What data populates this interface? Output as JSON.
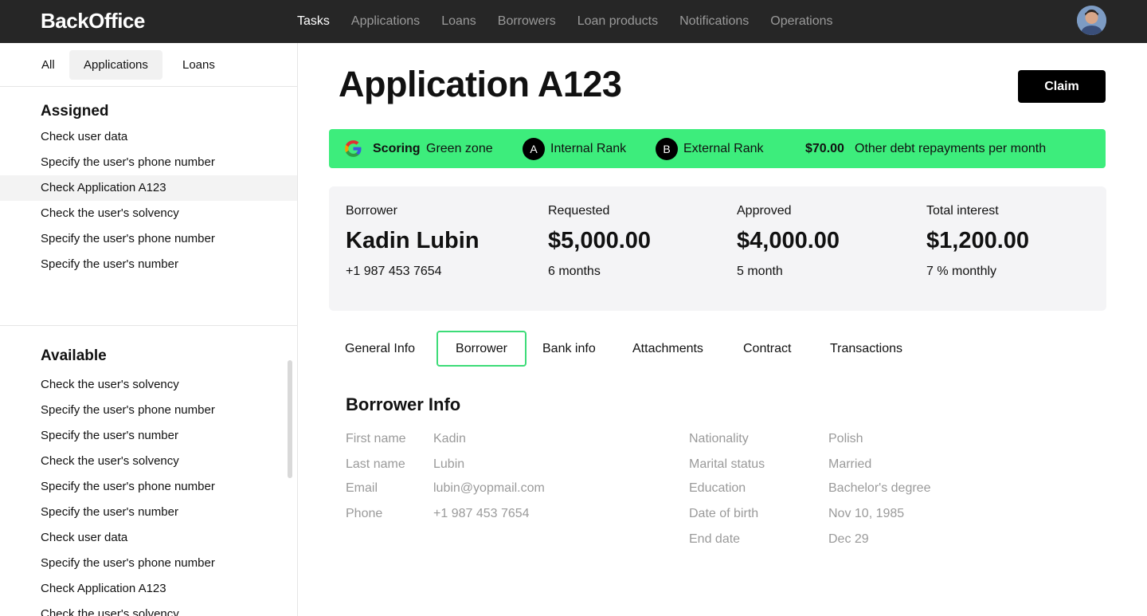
{
  "header": {
    "logo": "BackOffice",
    "nav": [
      "Tasks",
      "Applications",
      "Loans",
      "Borrowers",
      "Loan products",
      "Notifications",
      "Operations"
    ],
    "active_nav": "Tasks"
  },
  "sidebar": {
    "tabs": [
      "All",
      "Applications",
      "Loans"
    ],
    "active_tab": "Applications",
    "assigned": {
      "title": "Assigned",
      "items": [
        "Check user data",
        "Specify the user's phone number",
        "Check Application A123",
        "Check the user's solvency",
        "Specify the user's phone number",
        "Specify the user's number"
      ],
      "selected": "Check Application A123"
    },
    "available": {
      "title": "Available",
      "items": [
        "Check the user's solvency",
        "Specify the user's phone number",
        "Specify the user's number",
        "Check the user's solvency",
        "Specify the user's phone number",
        "Specify the user's number",
        "Check user data",
        "Specify the user's phone number",
        "Check Application A123",
        "Check the user's solvency"
      ]
    }
  },
  "main": {
    "title": "Application A123",
    "claim_label": "Claim",
    "banner": {
      "scoring_label": "Scoring",
      "scoring_value": "Green zone",
      "internal_rank_badge": "A",
      "internal_rank_label": "Internal Rank",
      "external_rank_badge": "B",
      "external_rank_label": "External Rank",
      "debt_amount": "$70.00",
      "debt_label": "Other debt repayments per month",
      "color": "#3ded7c"
    },
    "summary": [
      {
        "label": "Borrower",
        "value": "Kadin Lubin",
        "sub": "+1 987 453 7654"
      },
      {
        "label": "Requested",
        "value": "$5,000.00",
        "sub": "6 months"
      },
      {
        "label": "Approved",
        "value": "$4,000.00",
        "sub": "5 month"
      },
      {
        "label": "Total interest",
        "value": "$1,200.00",
        "sub": "7 % monthly"
      }
    ],
    "tabs": [
      "General Info",
      "Borrower",
      "Bank info",
      "Attachments",
      "Contract",
      "Transactions"
    ],
    "active_tab": "Borrower",
    "borrower_info": {
      "title": "Borrower Info",
      "left": [
        {
          "label": "First name",
          "value": "Kadin"
        },
        {
          "label": "Last name",
          "value": "Lubin"
        },
        {
          "label": "Email",
          "value": "lubin@yopmail.com"
        },
        {
          "label": "Phone",
          "value": "+1 987 453 7654"
        }
      ],
      "right": [
        {
          "label": "Nationality",
          "value": "Polish"
        },
        {
          "label": "Marital status",
          "value": "Married"
        },
        {
          "label": "Education",
          "value": "Bachelor's degree"
        },
        {
          "label": "Date of birth",
          "value": "Nov 10, 1985"
        },
        {
          "label": "End date",
          "value": "Dec 29"
        }
      ]
    }
  }
}
